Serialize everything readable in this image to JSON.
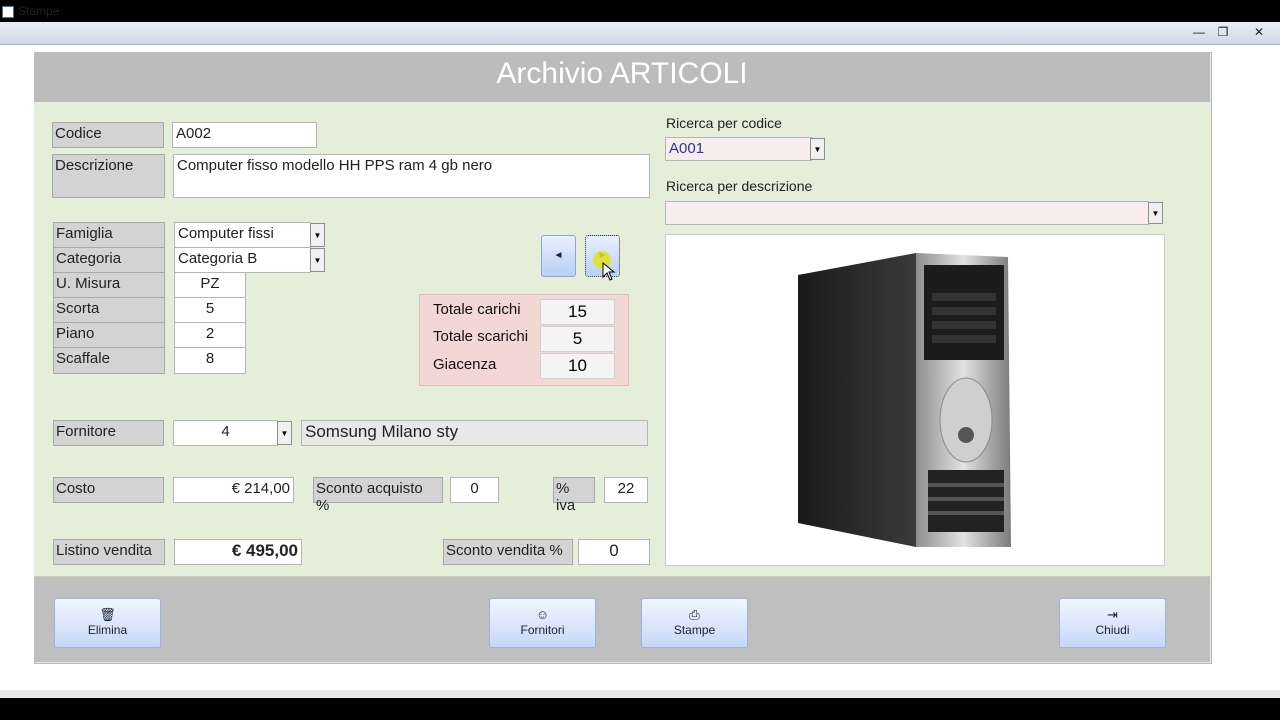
{
  "window": {
    "title": "Stampe",
    "min": "—",
    "max": "❐",
    "close": "✕"
  },
  "header": {
    "title": "Archivio ARTICOLI"
  },
  "fields": {
    "codice": {
      "label": "Codice",
      "value": "A002"
    },
    "descrizione": {
      "label": "Descrizione",
      "value": "Computer fisso modello HH PPS ram 4 gb nero"
    },
    "famiglia": {
      "label": "Famiglia",
      "value": "Computer fissi"
    },
    "categoria": {
      "label": "Categoria",
      "value": "Categoria B"
    },
    "umisura": {
      "label": "U. Misura",
      "value": "PZ"
    },
    "scorta": {
      "label": "Scorta",
      "value": "5"
    },
    "piano": {
      "label": "Piano",
      "value": "2"
    },
    "scaffale": {
      "label": "Scaffale",
      "value": "8"
    },
    "fornitore": {
      "label": "Fornitore",
      "value": "4",
      "name": "Somsung Milano sty"
    },
    "costo": {
      "label": "Costo",
      "value": "€ 214,00"
    },
    "sconto_acquisto": {
      "label": "Sconto acquisto %",
      "value": "0"
    },
    "iva": {
      "label": "% iva",
      "value": "22"
    },
    "listino": {
      "label": "Listino vendita",
      "value": "€ 495,00"
    },
    "sconto_vendita": {
      "label": "Sconto vendita %",
      "value": "0"
    }
  },
  "totals": {
    "carichi": {
      "label": "Totale carichi",
      "value": "15"
    },
    "scarichi": {
      "label": "Totale scarichi",
      "value": "5"
    },
    "giacenza": {
      "label": "Giacenza",
      "value": "10"
    }
  },
  "search": {
    "codice_label": "Ricerca per codice",
    "codice_value": "A001",
    "descrizione_label": "Ricerca per descrizione",
    "descrizione_value": ""
  },
  "nav": {
    "prev": "◄",
    "next": "►"
  },
  "footer": {
    "elimina": "Elimina",
    "fornitori": "Fornitori",
    "stampe": "Stampe",
    "chiudi": "Chiudi"
  },
  "colors": {
    "accent": "#4a6ea8",
    "form_bg": "#e5eed9",
    "totals_bg": "#f2d7d5",
    "highlight": "#e3e31a"
  }
}
